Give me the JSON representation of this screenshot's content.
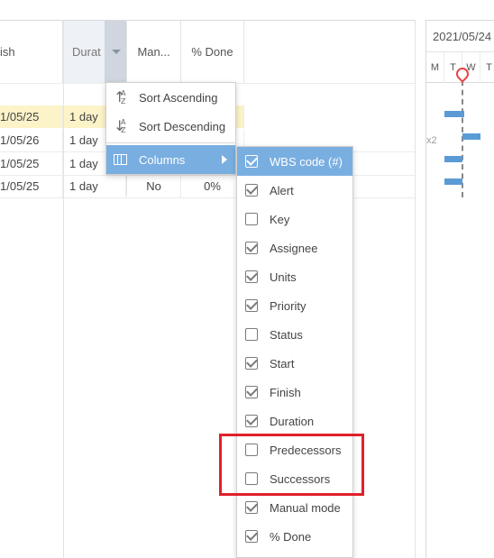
{
  "grid": {
    "columns": [
      {
        "key": "finish",
        "label": "ish"
      },
      {
        "key": "duration",
        "label": "Durat"
      },
      {
        "key": "manual",
        "label": "Man..."
      },
      {
        "key": "percent",
        "label": "% Done"
      }
    ],
    "rows": [
      {
        "finish": "1/05/25",
        "duration": "1 day",
        "manual": "",
        "percent": "",
        "selected": true
      },
      {
        "finish": "1/05/26",
        "duration": "1 day",
        "manual": "",
        "percent": "",
        "selected": false
      },
      {
        "finish": "1/05/25",
        "duration": "1 day",
        "manual": "",
        "percent": "",
        "selected": false
      },
      {
        "finish": "1/05/25",
        "duration": "1 day",
        "manual": "No",
        "percent": "0%",
        "selected": false
      }
    ]
  },
  "gantt": {
    "date": "2021/05/24",
    "days": [
      "M",
      "T",
      "W",
      "T"
    ],
    "label_x2": "x2",
    "colors": {
      "bar": "#5b9bd5",
      "today": "#e64545"
    }
  },
  "context_menu": {
    "sort_ascending": "Sort Ascending",
    "sort_descending": "Sort Descending",
    "columns": "Columns"
  },
  "columns_menu": [
    {
      "label": "WBS code (#)",
      "checked": true
    },
    {
      "label": "Alert",
      "checked": true
    },
    {
      "label": "Key",
      "checked": false
    },
    {
      "label": "Assignee",
      "checked": true
    },
    {
      "label": "Units",
      "checked": true
    },
    {
      "label": "Priority",
      "checked": true
    },
    {
      "label": "Status",
      "checked": false
    },
    {
      "label": "Start",
      "checked": true
    },
    {
      "label": "Finish",
      "checked": true
    },
    {
      "label": "Duration",
      "checked": true
    },
    {
      "label": "Predecessors",
      "checked": false
    },
    {
      "label": "Successors",
      "checked": false
    },
    {
      "label": "Manual mode",
      "checked": true
    },
    {
      "label": "% Done",
      "checked": true
    }
  ],
  "accent_color": "#79aee0",
  "highlight_color": "#e0202a"
}
